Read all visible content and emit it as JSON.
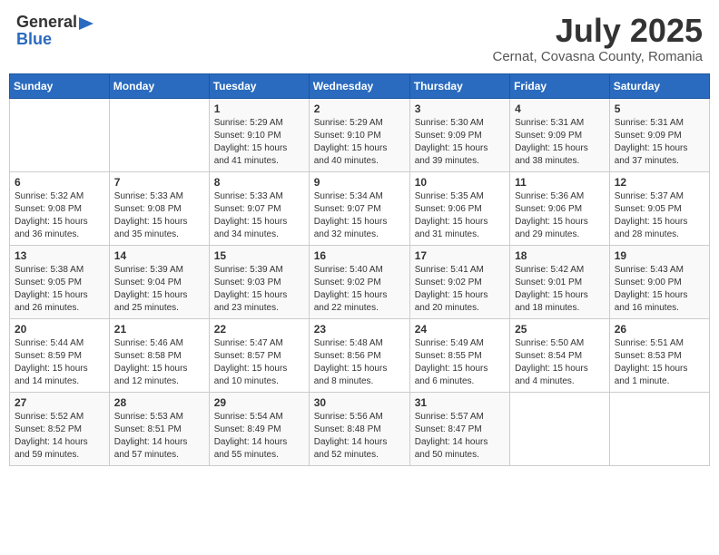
{
  "header": {
    "logo_general": "General",
    "logo_blue": "Blue",
    "month": "July 2025",
    "location": "Cernat, Covasna County, Romania"
  },
  "weekdays": [
    "Sunday",
    "Monday",
    "Tuesday",
    "Wednesday",
    "Thursday",
    "Friday",
    "Saturday"
  ],
  "weeks": [
    [
      {
        "day": "",
        "info": ""
      },
      {
        "day": "",
        "info": ""
      },
      {
        "day": "1",
        "info": "Sunrise: 5:29 AM\nSunset: 9:10 PM\nDaylight: 15 hours and 41 minutes."
      },
      {
        "day": "2",
        "info": "Sunrise: 5:29 AM\nSunset: 9:10 PM\nDaylight: 15 hours and 40 minutes."
      },
      {
        "day": "3",
        "info": "Sunrise: 5:30 AM\nSunset: 9:09 PM\nDaylight: 15 hours and 39 minutes."
      },
      {
        "day": "4",
        "info": "Sunrise: 5:31 AM\nSunset: 9:09 PM\nDaylight: 15 hours and 38 minutes."
      },
      {
        "day": "5",
        "info": "Sunrise: 5:31 AM\nSunset: 9:09 PM\nDaylight: 15 hours and 37 minutes."
      }
    ],
    [
      {
        "day": "6",
        "info": "Sunrise: 5:32 AM\nSunset: 9:08 PM\nDaylight: 15 hours and 36 minutes."
      },
      {
        "day": "7",
        "info": "Sunrise: 5:33 AM\nSunset: 9:08 PM\nDaylight: 15 hours and 35 minutes."
      },
      {
        "day": "8",
        "info": "Sunrise: 5:33 AM\nSunset: 9:07 PM\nDaylight: 15 hours and 34 minutes."
      },
      {
        "day": "9",
        "info": "Sunrise: 5:34 AM\nSunset: 9:07 PM\nDaylight: 15 hours and 32 minutes."
      },
      {
        "day": "10",
        "info": "Sunrise: 5:35 AM\nSunset: 9:06 PM\nDaylight: 15 hours and 31 minutes."
      },
      {
        "day": "11",
        "info": "Sunrise: 5:36 AM\nSunset: 9:06 PM\nDaylight: 15 hours and 29 minutes."
      },
      {
        "day": "12",
        "info": "Sunrise: 5:37 AM\nSunset: 9:05 PM\nDaylight: 15 hours and 28 minutes."
      }
    ],
    [
      {
        "day": "13",
        "info": "Sunrise: 5:38 AM\nSunset: 9:05 PM\nDaylight: 15 hours and 26 minutes."
      },
      {
        "day": "14",
        "info": "Sunrise: 5:39 AM\nSunset: 9:04 PM\nDaylight: 15 hours and 25 minutes."
      },
      {
        "day": "15",
        "info": "Sunrise: 5:39 AM\nSunset: 9:03 PM\nDaylight: 15 hours and 23 minutes."
      },
      {
        "day": "16",
        "info": "Sunrise: 5:40 AM\nSunset: 9:02 PM\nDaylight: 15 hours and 22 minutes."
      },
      {
        "day": "17",
        "info": "Sunrise: 5:41 AM\nSunset: 9:02 PM\nDaylight: 15 hours and 20 minutes."
      },
      {
        "day": "18",
        "info": "Sunrise: 5:42 AM\nSunset: 9:01 PM\nDaylight: 15 hours and 18 minutes."
      },
      {
        "day": "19",
        "info": "Sunrise: 5:43 AM\nSunset: 9:00 PM\nDaylight: 15 hours and 16 minutes."
      }
    ],
    [
      {
        "day": "20",
        "info": "Sunrise: 5:44 AM\nSunset: 8:59 PM\nDaylight: 15 hours and 14 minutes."
      },
      {
        "day": "21",
        "info": "Sunrise: 5:46 AM\nSunset: 8:58 PM\nDaylight: 15 hours and 12 minutes."
      },
      {
        "day": "22",
        "info": "Sunrise: 5:47 AM\nSunset: 8:57 PM\nDaylight: 15 hours and 10 minutes."
      },
      {
        "day": "23",
        "info": "Sunrise: 5:48 AM\nSunset: 8:56 PM\nDaylight: 15 hours and 8 minutes."
      },
      {
        "day": "24",
        "info": "Sunrise: 5:49 AM\nSunset: 8:55 PM\nDaylight: 15 hours and 6 minutes."
      },
      {
        "day": "25",
        "info": "Sunrise: 5:50 AM\nSunset: 8:54 PM\nDaylight: 15 hours and 4 minutes."
      },
      {
        "day": "26",
        "info": "Sunrise: 5:51 AM\nSunset: 8:53 PM\nDaylight: 15 hours and 1 minute."
      }
    ],
    [
      {
        "day": "27",
        "info": "Sunrise: 5:52 AM\nSunset: 8:52 PM\nDaylight: 14 hours and 59 minutes."
      },
      {
        "day": "28",
        "info": "Sunrise: 5:53 AM\nSunset: 8:51 PM\nDaylight: 14 hours and 57 minutes."
      },
      {
        "day": "29",
        "info": "Sunrise: 5:54 AM\nSunset: 8:49 PM\nDaylight: 14 hours and 55 minutes."
      },
      {
        "day": "30",
        "info": "Sunrise: 5:56 AM\nSunset: 8:48 PM\nDaylight: 14 hours and 52 minutes."
      },
      {
        "day": "31",
        "info": "Sunrise: 5:57 AM\nSunset: 8:47 PM\nDaylight: 14 hours and 50 minutes."
      },
      {
        "day": "",
        "info": ""
      },
      {
        "day": "",
        "info": ""
      }
    ]
  ]
}
